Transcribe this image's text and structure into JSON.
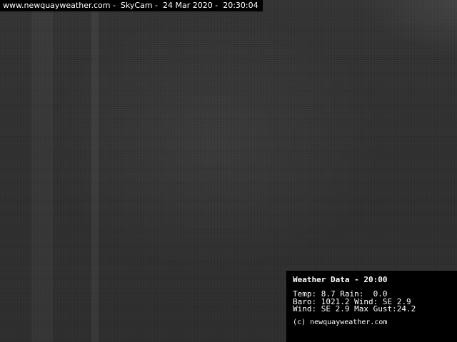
{
  "header": {
    "caption": "www.newquayweather.com -  SkyCam -  24 Mar 2020 -  20:30:04"
  },
  "weather_panel": {
    "title": "Weather Data - 20:00",
    "line1": "Temp: 8.7 Rain:  0.0",
    "line2": "Baro: 1021.2 Wind: SE 2.9",
    "line3": "Wind: SE 2.9 Max Gust:24.2",
    "copyright": "(c) newquayweather.com"
  }
}
